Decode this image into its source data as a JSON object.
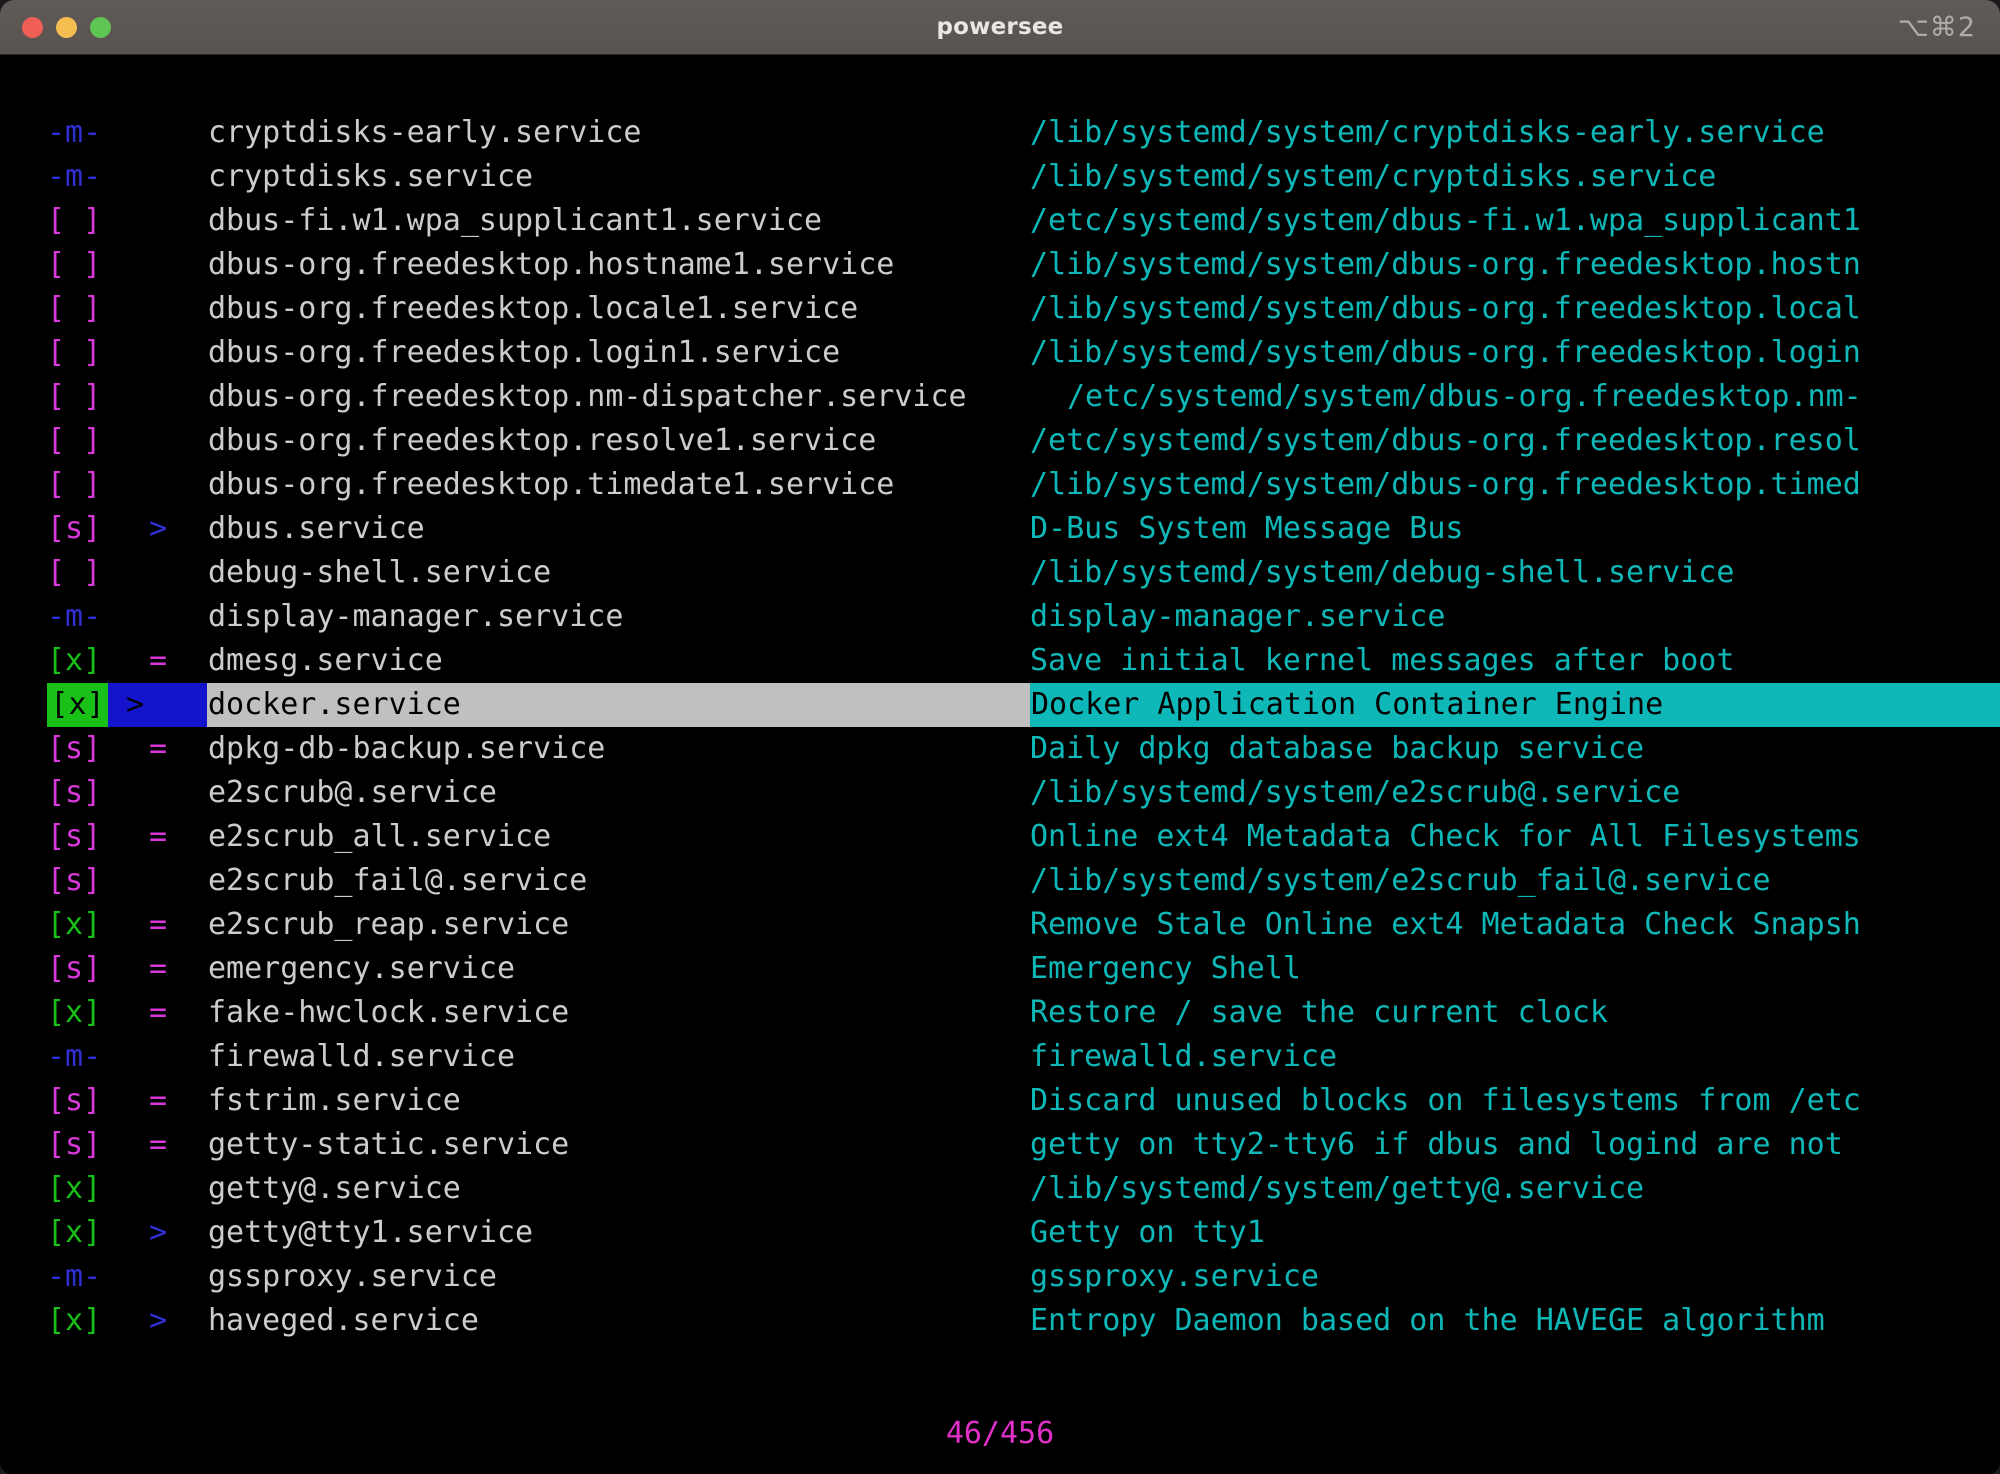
{
  "window": {
    "title": "powersee",
    "shortcut": "⌥⌘2",
    "controls": [
      "close-button",
      "minimize-button",
      "zoom-button"
    ]
  },
  "colors": {
    "background": "#000000",
    "titlebar": "#5c5753",
    "state_enabled": "#18c018",
    "state_static": "#d838d8",
    "state_masked": "#2f2fd4",
    "name_text": "#cccccc",
    "description": "#0fb8b8",
    "status": "#e030c8",
    "selected_name_bg": "#c0c0c0",
    "selected_desc_bg": "#0fb8b8",
    "selected_mark_bg": "#1414cc"
  },
  "list": {
    "selected_index": 14,
    "rows": [
      {
        "state": "-m-",
        "state_kind": "masked",
        "mark": "",
        "name": "cryptdisks-early.service",
        "desc": "/lib/systemd/system/cryptdisks-early.service",
        "shift": false
      },
      {
        "state": "-m-",
        "state_kind": "masked",
        "mark": "",
        "name": "cryptdisks.service",
        "desc": "/lib/systemd/system/cryptdisks.service",
        "shift": false
      },
      {
        "state": "[ ]",
        "state_kind": "disabled",
        "mark": "",
        "name": "dbus-fi.w1.wpa_supplicant1.service",
        "desc": "/etc/systemd/system/dbus-fi.w1.wpa_supplicant1",
        "shift": false
      },
      {
        "state": "[ ]",
        "state_kind": "disabled",
        "mark": "",
        "name": "dbus-org.freedesktop.hostname1.service",
        "desc": "/lib/systemd/system/dbus-org.freedesktop.hostn",
        "shift": false
      },
      {
        "state": "[ ]",
        "state_kind": "disabled",
        "mark": "",
        "name": "dbus-org.freedesktop.locale1.service",
        "desc": "/lib/systemd/system/dbus-org.freedesktop.local",
        "shift": false
      },
      {
        "state": "[ ]",
        "state_kind": "disabled",
        "mark": "",
        "name": "dbus-org.freedesktop.login1.service",
        "desc": "/lib/systemd/system/dbus-org.freedesktop.login",
        "shift": false
      },
      {
        "state": "[ ]",
        "state_kind": "disabled",
        "mark": "",
        "name": "dbus-org.freedesktop.nm-dispatcher.service",
        "desc": "/etc/systemd/system/dbus-org.freedesktop.nm-",
        "shift": true
      },
      {
        "state": "[ ]",
        "state_kind": "disabled",
        "mark": "",
        "name": "dbus-org.freedesktop.resolve1.service",
        "desc": "/etc/systemd/system/dbus-org.freedesktop.resol",
        "shift": false
      },
      {
        "state": "[ ]",
        "state_kind": "disabled",
        "mark": "",
        "name": "dbus-org.freedesktop.timedate1.service",
        "desc": "/lib/systemd/system/dbus-org.freedesktop.timed",
        "shift": false
      },
      {
        "state": "[s]",
        "state_kind": "static",
        "mark": ">",
        "name": "dbus.service",
        "desc": "D-Bus System Message Bus",
        "shift": false
      },
      {
        "state": "[ ]",
        "state_kind": "disabled",
        "mark": "",
        "name": "debug-shell.service",
        "desc": "/lib/systemd/system/debug-shell.service",
        "shift": false
      },
      {
        "state": "-m-",
        "state_kind": "masked",
        "mark": "",
        "name": "display-manager.service",
        "desc": "display-manager.service",
        "shift": false
      },
      {
        "state": "[x]",
        "state_kind": "enabled",
        "mark": "=",
        "name": "dmesg.service",
        "desc": "Save initial kernel messages after boot",
        "shift": false
      },
      {
        "state": "[x]",
        "state_kind": "enabled",
        "mark": ">",
        "name": "docker.service",
        "desc": "Docker Application Container Engine",
        "shift": false,
        "selected": true
      },
      {
        "state": "[s]",
        "state_kind": "static",
        "mark": "=",
        "name": "dpkg-db-backup.service",
        "desc": "Daily dpkg database backup service",
        "shift": false
      },
      {
        "state": "[s]",
        "state_kind": "static",
        "mark": "",
        "name": "e2scrub@.service",
        "desc": "/lib/systemd/system/e2scrub@.service",
        "shift": false
      },
      {
        "state": "[s]",
        "state_kind": "static",
        "mark": "=",
        "name": "e2scrub_all.service",
        "desc": "Online ext4 Metadata Check for All Filesystems",
        "shift": false
      },
      {
        "state": "[s]",
        "state_kind": "static",
        "mark": "",
        "name": "e2scrub_fail@.service",
        "desc": "/lib/systemd/system/e2scrub_fail@.service",
        "shift": false
      },
      {
        "state": "[x]",
        "state_kind": "enabled",
        "mark": "=",
        "name": "e2scrub_reap.service",
        "desc": "Remove Stale Online ext4 Metadata Check Snapsh",
        "shift": false
      },
      {
        "state": "[s]",
        "state_kind": "static",
        "mark": "=",
        "name": "emergency.service",
        "desc": "Emergency Shell",
        "shift": false
      },
      {
        "state": "[x]",
        "state_kind": "enabled",
        "mark": "=",
        "name": "fake-hwclock.service",
        "desc": "Restore / save the current clock",
        "shift": false
      },
      {
        "state": "-m-",
        "state_kind": "masked",
        "mark": "",
        "name": "firewalld.service",
        "desc": "firewalld.service",
        "shift": false
      },
      {
        "state": "[s]",
        "state_kind": "static",
        "mark": "=",
        "name": "fstrim.service",
        "desc": "Discard unused blocks on filesystems from /etc",
        "shift": false
      },
      {
        "state": "[s]",
        "state_kind": "static",
        "mark": "=",
        "name": "getty-static.service",
        "desc": "getty on tty2-tty6 if dbus and logind are not",
        "shift": false
      },
      {
        "state": "[x]",
        "state_kind": "enabled",
        "mark": "",
        "name": "getty@.service",
        "desc": "/lib/systemd/system/getty@.service",
        "shift": false
      },
      {
        "state": "[x]",
        "state_kind": "enabled",
        "mark": ">",
        "name": "getty@tty1.service",
        "desc": "Getty on tty1",
        "shift": false
      },
      {
        "state": "-m-",
        "state_kind": "masked",
        "mark": "",
        "name": "gssproxy.service",
        "desc": "gssproxy.service",
        "shift": false
      },
      {
        "state": "[x]",
        "state_kind": "enabled",
        "mark": ">",
        "name": "haveged.service",
        "desc": "Entropy Daemon based on the HAVEGE algorithm",
        "shift": false
      }
    ]
  },
  "status": {
    "counter": "46/456",
    "current": 46,
    "total": 456
  }
}
